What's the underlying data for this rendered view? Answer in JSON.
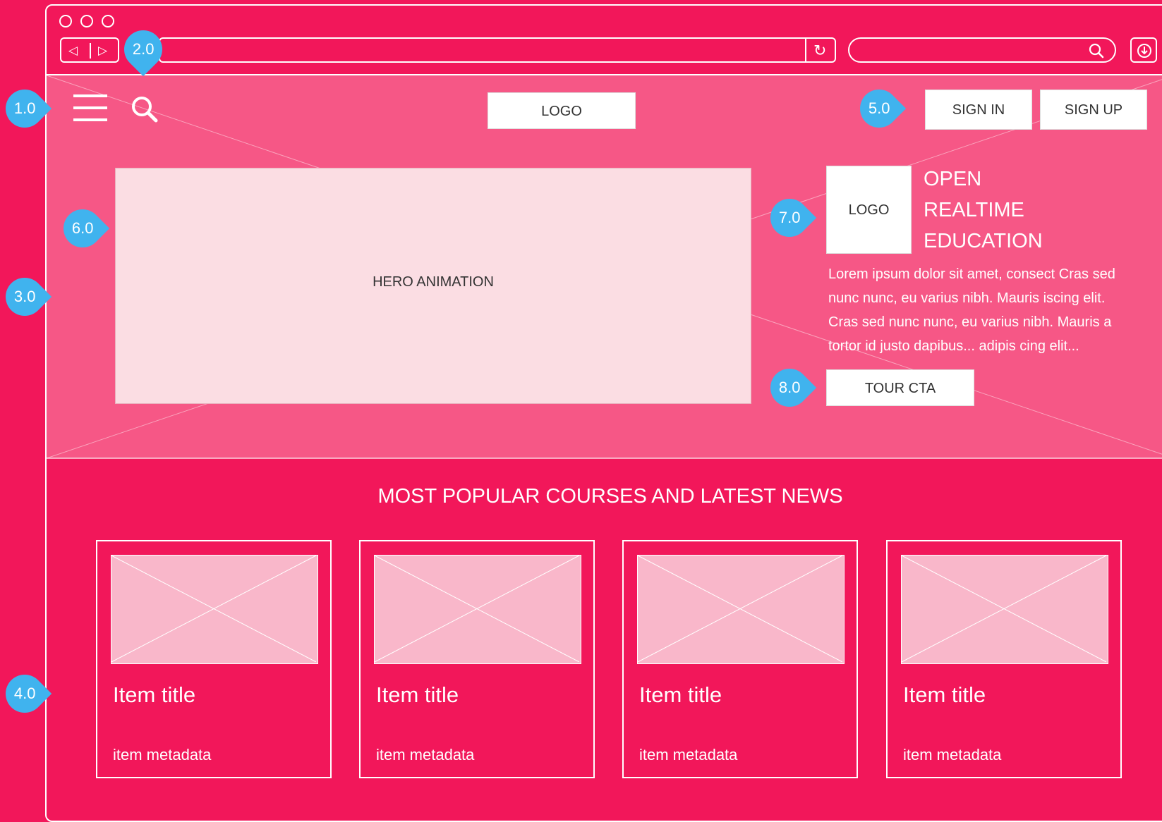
{
  "browser": {
    "back_glyph": "◁",
    "forward_glyph": "▷",
    "reload_glyph": "↻"
  },
  "header": {
    "logo_label": "LOGO",
    "sign_in_label": "SIGN IN",
    "sign_up_label": "SIGN UP"
  },
  "hero": {
    "animation_label": "HERO ANIMATION",
    "logo_label": "LOGO",
    "tagline": [
      "OPEN",
      "REALTIME",
      "EDUCATION"
    ],
    "description": [
      "Lorem ipsum dolor sit amet, consect Cras sed",
      "nunc nunc, eu varius nibh. Mauris iscing elit.",
      "Cras sed nunc nunc, eu varius nibh. Mauris a",
      "tortor id justo dapibus... adipis cing elit..."
    ],
    "cta_label": "TOUR CTA"
  },
  "courses": {
    "heading": "MOST POPULAR COURSES AND LATEST NEWS",
    "items": [
      {
        "title": "Item title",
        "meta": "item metadata"
      },
      {
        "title": "Item title",
        "meta": "item metadata"
      },
      {
        "title": "Item title",
        "meta": "item metadata"
      },
      {
        "title": "Item title",
        "meta": "item metadata"
      }
    ]
  },
  "annotations": [
    "1.0",
    "2.0",
    "3.0",
    "4.0",
    "5.0",
    "6.0",
    "7.0",
    "8.0"
  ],
  "icons": [
    "menu-icon",
    "search-icon",
    "reload-icon",
    "download-icon"
  ],
  "colors": {
    "background": "#F2175A",
    "hero_overlay": "#F65786",
    "hero_animation": "#FBDDE3",
    "thumbnail": "#F9B7CA",
    "annotation_pin": "#40B3EE",
    "button_fill": "#FFFFFF"
  }
}
